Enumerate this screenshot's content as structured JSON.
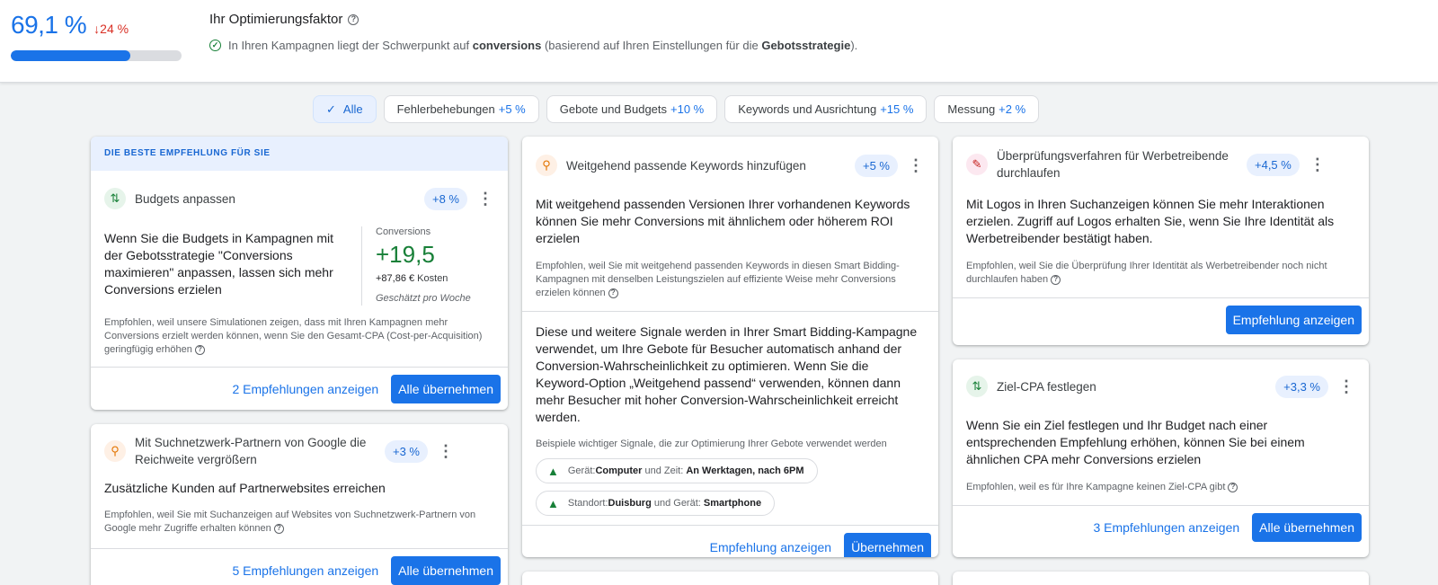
{
  "header": {
    "score": "69,1 %",
    "delta": "24 %",
    "progress_fraction": 0.7,
    "title": "Ihr Optimierungsfaktor",
    "subtitle_pre": "In Ihren Kampagnen liegt der Schwerpunkt auf ",
    "subtitle_bold1": "conversions",
    "subtitle_mid": " (basierend auf Ihren Einstellungen für die ",
    "subtitle_bold2": "Gebotsstrategie",
    "subtitle_post": ")."
  },
  "chips": [
    {
      "label": "Alle",
      "pct": ""
    },
    {
      "label": "Fehlerbehebungen",
      "pct": "+5 %"
    },
    {
      "label": "Gebote und Budgets",
      "pct": "+10 %"
    },
    {
      "label": "Keywords und Ausrichtung",
      "pct": "+15 %"
    },
    {
      "label": "Messung",
      "pct": "+2 %"
    }
  ],
  "cards": {
    "budgets": {
      "banner": "DIE BESTE EMPFEHLUNG FÜR SIE",
      "title": "Budgets anpassen",
      "badge": "+8 %",
      "desc": "Wenn Sie die Budgets in Kampagnen mit der Gebotsstrategie \"Conversions maximieren\" anpassen, lassen sich mehr Conversions erzielen",
      "metric_label": "Conversions",
      "metric_value": "+19,5",
      "metric_cost_value": "+87,86 €",
      "metric_cost_label": " Kosten",
      "metric_note": "Geschätzt pro Woche",
      "reason": "Empfohlen, weil unsere Simulationen zeigen, dass mit Ihren Kampagnen mehr Conversions erzielt werden können, wenn Sie den Gesamt-CPA (Cost-per-Acquisition) geringfügig erhöhen",
      "link": "2 Empfehlungen anzeigen",
      "button": "Alle übernehmen"
    },
    "partners": {
      "title": "Mit Suchnetzwerk-Partnern von Google die Reichweite vergrößern",
      "badge": "+3 %",
      "desc": "Zusätzliche Kunden auf Partnerwebsites erreichen",
      "reason": "Empfohlen, weil Sie mit Suchanzeigen auf Websites von Suchnetzwerk-Partnern von Google mehr Zugriffe erhalten können",
      "link": "5 Empfehlungen anzeigen",
      "button": "Alle übernehmen"
    },
    "keywords": {
      "title": "Weitgehend passende Keywords hinzufügen",
      "badge": "+5 %",
      "desc": "Mit weitgehend passenden Versionen Ihrer vorhandenen Keywords können Sie mehr Conversions mit ähnlichem oder höherem ROI erzielen",
      "reason": "Empfohlen, weil Sie mit weitgehend passenden Keywords in diesen Smart Bidding-Kampagnen mit denselben Leistungszielen auf effiziente Weise mehr Conversions erzielen können",
      "signals_text": "Diese und weitere Signale werden in Ihrer Smart Bidding-Kampagne verwendet, um Ihre Gebote für Besucher automatisch anhand der Conversion-Wahrscheinlichkeit zu optimieren. Wenn Sie die Keyword-Option „Weitgehend passend“ verwenden, können dann mehr Besucher mit hoher Conversion-Wahrscheinlichkeit erreicht werden.",
      "signals_label": "Beispiele wichtiger Signale, die zur Optimierung Ihrer Gebote verwendet werden",
      "signal1": {
        "a": "Gerät: ",
        "b": "Computer",
        "c": " und Zeit: ",
        "d": "An Werktagen, nach 6PM"
      },
      "signal2": {
        "a": "Standort: ",
        "b": "Duisburg",
        "c": " und Gerät: ",
        "d": "Smartphone"
      },
      "link": "Empfehlung anzeigen",
      "button": "Übernehmen"
    },
    "verify": {
      "title": "Überprüfungsverfahren für Werbetreibende durchlaufen",
      "badge": "+4,5 %",
      "desc": "Mit Logos in Ihren Suchanzeigen können Sie mehr Interaktionen erzielen. Zugriff auf Logos erhalten Sie, wenn Sie Ihre Identität als Werbetreibender bestätigt haben.",
      "reason": "Empfohlen, weil Sie die Überprüfung Ihrer Identität als Werbetreibender noch nicht durchlaufen haben",
      "button": "Empfehlung anzeigen"
    },
    "cpa": {
      "title": "Ziel-CPA festlegen",
      "badge": "+3,3 %",
      "desc": "Wenn Sie ein Ziel festlegen und Ihr Budget nach einer entsprechenden Empfehlung erhöhen, können Sie bei einem ähnlichen CPA mehr Conversions erzielen",
      "reason": "Empfohlen, weil es für Ihre Kampagne keinen Ziel-CPA gibt",
      "link": "3 Empfehlungen anzeigen",
      "button": "Alle übernehmen"
    }
  }
}
